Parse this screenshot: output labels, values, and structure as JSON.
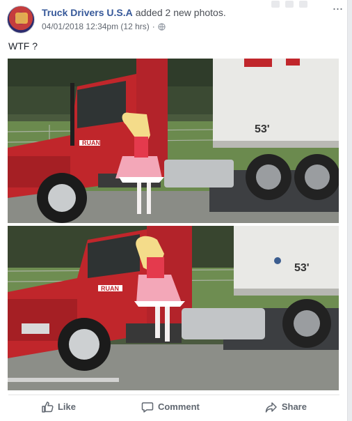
{
  "post": {
    "page_name": "Truck Drivers U.S.A",
    "action_text": "added 2 new photos.",
    "timestamp": "04/01/2018 12:34pm (12 hrs)",
    "separator": "·",
    "privacy_icon": "globe-icon",
    "more_label": "···",
    "caption": "WTF ?"
  },
  "photos": [
    {
      "icon": "photo-truck-top",
      "trailer_text": "53'",
      "cab_text": "RUAN"
    },
    {
      "icon": "photo-truck-bottom",
      "trailer_text": "53'",
      "cab_text": "RUAN"
    }
  ],
  "actions": {
    "like_label": "Like",
    "comment_label": "Comment",
    "share_label": "Share"
  },
  "colors": {
    "link": "#365899",
    "muted": "#616770",
    "action_text": "#606770",
    "truck_red": "#c0262b"
  }
}
